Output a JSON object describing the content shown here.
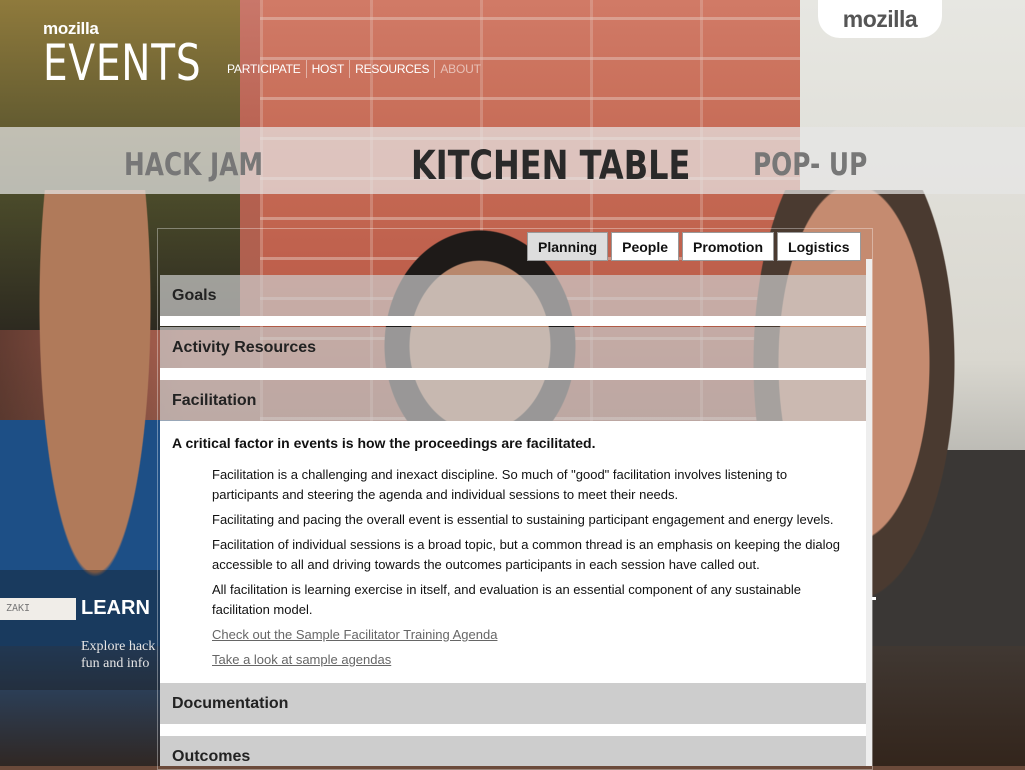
{
  "brand_tab": "mozilla",
  "logo": {
    "small": "mozilla",
    "big": "EVENTS"
  },
  "nav": [
    "PARTICIPATE",
    "HOST",
    "RESOURCES",
    "ABOUT"
  ],
  "event_types": {
    "left": "HACK JAM",
    "center": "KITCHEN TABLE",
    "right": "POP- UP"
  },
  "teaser": {
    "title": "LEARN",
    "text_line1": "Explore hack",
    "text_line2": "fun and info",
    "name_tag": "ZAKI"
  },
  "tabs": [
    {
      "label": "Planning",
      "active": true
    },
    {
      "label": "People",
      "active": false
    },
    {
      "label": "Promotion",
      "active": false
    },
    {
      "label": "Logistics",
      "active": false
    }
  ],
  "sections": {
    "goals": "Goals",
    "activity_resources": "Activity Resources",
    "facilitation": "Facilitation",
    "documentation": "Documentation",
    "outcomes": "Outcomes"
  },
  "facilitation": {
    "lead": "A critical factor in events is how the proceedings are facilitated.",
    "paragraphs": [
      "Facilitation is a challenging and inexact discipline. So much of \"good\" facilitation involves listening to participants and steering the agenda and individual sessions to meet their needs.",
      "Facilitating and pacing the overall event is essential to sustaining participant engagement and energy levels.",
      "Facilitation of individual sessions is a broad topic, but a common thread is an emphasis on keeping the dialog accessible to all and driving towards the outcomes participants in each session have called out.",
      "All facilitation is learning exercise in itself, and evaluation is an essential component of any sustainable facilitation model."
    ],
    "links": [
      "Check out the Sample Facilitator Training Agenda",
      "Take a look at sample agendas"
    ]
  },
  "colors": {
    "active_tab": "#dddddd",
    "section_bar": "#cdcdcd",
    "link": "#666666"
  }
}
